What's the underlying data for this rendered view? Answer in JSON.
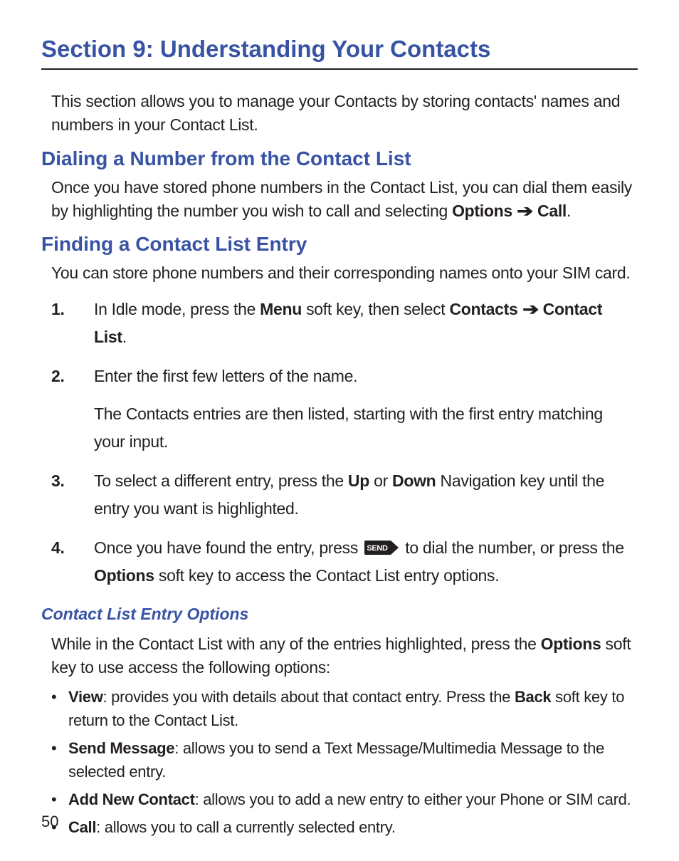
{
  "section_title": "Section 9: Understanding Your Contacts",
  "intro": "This section allows you to manage your Contacts by storing contacts' names and numbers in your Contact List.",
  "h2a": "Dialing a Number from the Contact List",
  "dialing_p1_a": "Once you have stored phone numbers in the Contact List, you can dial them easily by highlighting the number you wish to call and selecting ",
  "dialing_options": "Options",
  "dialing_call": "Call",
  "period": ".",
  "h2b": "Finding a Contact List Entry",
  "finding_intro": "You can store phone numbers and their corresponding names onto your SIM card.",
  "steps": {
    "s1_a": "In Idle mode, press the ",
    "s1_menu": "Menu",
    "s1_b": " soft key, then select ",
    "s1_contacts": "Contacts",
    "s1_contact_list": "Contact List",
    "s2": "Enter the first few letters of the name.",
    "s2_follow": "The Contacts entries are then listed, starting with the first entry matching your input.",
    "s3_a": "To select a different entry, press the ",
    "s3_up": "Up",
    "s3_or": " or ",
    "s3_down": "Down",
    "s3_b": " Navigation key until the entry you want is highlighted.",
    "s4_a": "Once you have found the entry, press ",
    "s4_b": " to dial the number, or press the ",
    "s4_options": "Options",
    "s4_c": " soft key to access the Contact List entry options."
  },
  "h3": "Contact List Entry Options",
  "options_intro_a": "While in the Contact List with any of the entries highlighted, press the ",
  "options_intro_b": "Options",
  "options_intro_c": " soft key to use access the following options:",
  "bullets": {
    "view_label": "View",
    "view_text": ": provides you with details about that contact entry. Press the ",
    "view_back": "Back",
    "view_text2": " soft key to return to the Contact List.",
    "send_label": "Send Message",
    "send_text": ": allows you to send a Text Message/Multimedia Message to the selected entry.",
    "add_label": "Add New Contact",
    "add_text": ": allows you to add a new entry to either your Phone or SIM card.",
    "call_label": "Call",
    "call_text": ": allows you to call a currently selected entry."
  },
  "send_key_label": "SEND",
  "page_number": "50"
}
